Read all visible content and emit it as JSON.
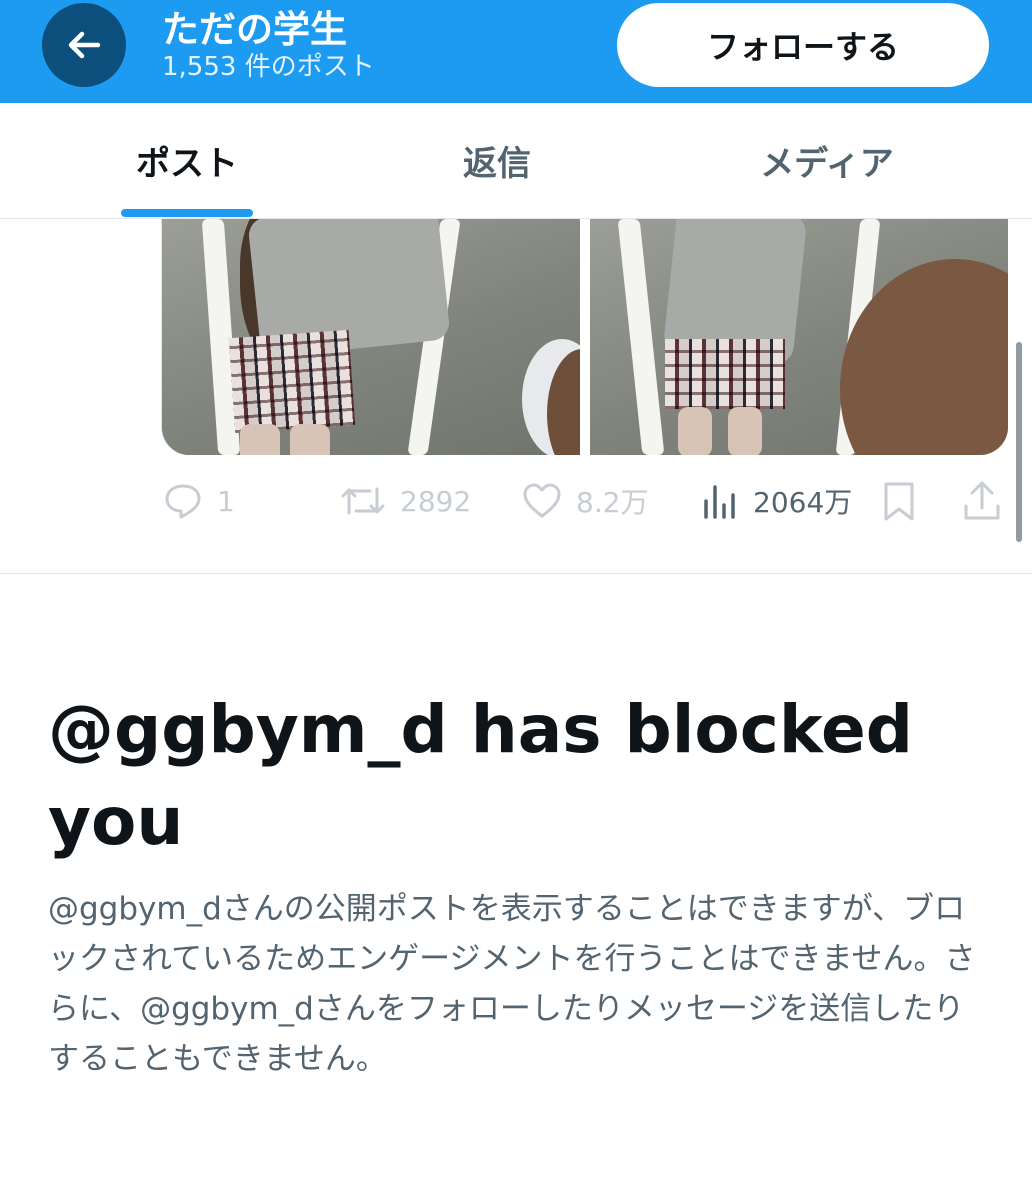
{
  "header": {
    "back_icon": "arrow-left-icon",
    "title": "ただの学生",
    "post_count": "1,553 件のポスト",
    "follow_label": "フォローする",
    "accent": "#1d9bf0"
  },
  "tabs": [
    {
      "label": "ポスト",
      "active": true
    },
    {
      "label": "返信",
      "active": false
    },
    {
      "label": "メディア",
      "active": false
    }
  ],
  "actions": {
    "reply": {
      "icon": "reply-icon",
      "count": "1"
    },
    "repost": {
      "icon": "repost-icon",
      "count": "2892"
    },
    "like": {
      "icon": "heart-icon",
      "count": "8.2万"
    },
    "views": {
      "icon": "views-icon",
      "count": "2064万"
    },
    "bookmark": {
      "icon": "bookmark-icon"
    },
    "share": {
      "icon": "share-icon"
    }
  },
  "blocked": {
    "title": "@ggbym_d has blocked you",
    "message": "@ggbym_dさんの公開ポストを表示することはできますが、ブロックされているためエンゲージメントを行うことはできません。さらに、@ggbym_dさんをフォローしたりメッセージを送信したりすることもできません。"
  }
}
